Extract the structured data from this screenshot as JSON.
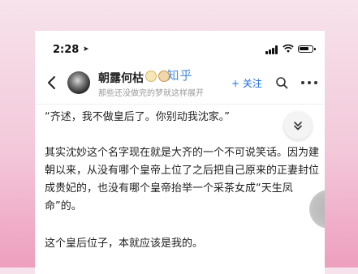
{
  "watermark": "知乎",
  "status_bar": {
    "time": "2:28"
  },
  "header": {
    "author_name": "朝露何枯",
    "bio": "那些还没做完的梦就这样展开",
    "follow_label": "+ 关注"
  },
  "content": {
    "p1": "“齐述，我不做皇后了。你别动我沈家。”",
    "p2": "其实沈妙这个名字现在就是大齐的一个不可说笑话。因为建朝以来，从没有哪个皇帝上位了之后把自己原来的正妻封位成贵妃的，也没有哪个皇帝抬举一个采茶女成“天生凤命”的。",
    "p3": "这个皇后位子，本就应该是我的。"
  },
  "colors": {
    "accent": "#1a6fe0",
    "watermark": "#4a8fe0"
  },
  "icons": [
    "location-arrow-icon",
    "signal-icon",
    "wifi-icon",
    "battery-icon",
    "back-icon",
    "search-icon",
    "more-icon",
    "chevron-double-down-icon"
  ]
}
